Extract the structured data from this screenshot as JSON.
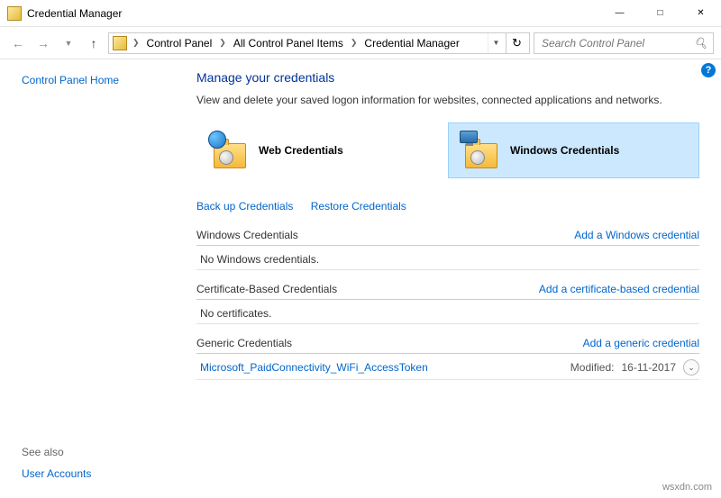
{
  "window": {
    "title": "Credential Manager"
  },
  "breadcrumbs": {
    "items": [
      "Control Panel",
      "All Control Panel Items",
      "Credential Manager"
    ]
  },
  "search": {
    "placeholder": "Search Control Panel"
  },
  "sidebar": {
    "home": "Control Panel Home",
    "see_also_label": "See also",
    "see_also_link": "User Accounts"
  },
  "page": {
    "title": "Manage your credentials",
    "subtitle": "View and delete your saved logon information for websites, connected applications and networks."
  },
  "tiles": {
    "web": "Web Credentials",
    "windows": "Windows Credentials"
  },
  "actions": {
    "backup": "Back up Credentials",
    "restore": "Restore Credentials"
  },
  "sections": {
    "windows": {
      "title": "Windows Credentials",
      "add": "Add a Windows credential",
      "empty": "No Windows credentials."
    },
    "cert": {
      "title": "Certificate-Based Credentials",
      "add": "Add a certificate-based credential",
      "empty": "No certificates."
    },
    "generic": {
      "title": "Generic Credentials",
      "add": "Add a generic credential"
    }
  },
  "generic_items": [
    {
      "name": "Microsoft_PaidConnectivity_WiFi_AccessToken",
      "modified_label": "Modified:",
      "modified_date": "16-11-2017"
    }
  ],
  "watermark": "wsxdn.com"
}
